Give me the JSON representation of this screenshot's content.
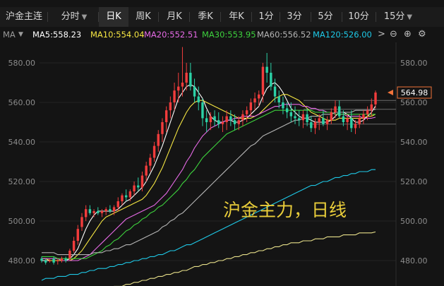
{
  "tabs": [
    {
      "label": "沪金主连",
      "active": false,
      "dropdown": false
    },
    {
      "label": "分时",
      "active": false,
      "dropdown": true
    },
    {
      "label": "日K",
      "active": true,
      "dropdown": false
    },
    {
      "label": "周K",
      "active": false,
      "dropdown": false
    },
    {
      "label": "月K",
      "active": false,
      "dropdown": false
    },
    {
      "label": "季K",
      "active": false,
      "dropdown": false
    },
    {
      "label": "年K",
      "active": false,
      "dropdown": false
    },
    {
      "label": "1分",
      "active": false,
      "dropdown": false
    },
    {
      "label": "3分",
      "active": false,
      "dropdown": false
    },
    {
      "label": "5分",
      "active": false,
      "dropdown": false
    },
    {
      "label": "10分",
      "active": false,
      "dropdown": false
    },
    {
      "label": "15分",
      "active": false,
      "dropdown": true
    }
  ],
  "ma_bar": {
    "prefix": "MA",
    "items": [
      {
        "label": "MA5:558.23",
        "color": "#ffffff"
      },
      {
        "label": "MA10:554.04",
        "color": "#f5e642"
      },
      {
        "label": "MA20:552.51",
        "color": "#e66ae6"
      },
      {
        "label": "MA30:553.95",
        "color": "#3dd13d"
      },
      {
        "label": "MA60:556.52",
        "color": "#b4b4b4"
      },
      {
        "label": "MA120:526.00",
        "color": "#1ec8e6"
      }
    ],
    "tools": {
      "next": ">",
      "zoom_out": "⊖",
      "zoom_in": "⊕",
      "settings": "⚙"
    }
  },
  "chart_data": {
    "type": "candlestick",
    "ylim": [
      470,
      590
    ],
    "yticks": [
      "580.00",
      "560.00",
      "540.00",
      "520.00",
      "500.00",
      "480.00"
    ],
    "last_price": "564.98",
    "annotation": "沪金主力，日线",
    "colors": {
      "up": "#f23c3c",
      "down": "#2bd1a6",
      "price_tag": "#f2733a"
    },
    "reference_lines": [
      561,
      556.5,
      549
    ],
    "candles": [
      [
        481,
        482,
        479,
        480
      ],
      [
        480,
        481,
        478,
        479
      ],
      [
        480,
        481,
        479,
        480
      ],
      [
        481,
        482,
        478,
        479
      ],
      [
        480,
        481,
        478,
        480
      ],
      [
        480,
        482,
        479,
        481
      ],
      [
        481,
        482,
        479,
        480
      ],
      [
        481,
        486,
        480,
        485
      ],
      [
        485,
        492,
        484,
        490
      ],
      [
        490,
        498,
        488,
        496
      ],
      [
        497,
        504,
        495,
        502
      ],
      [
        502,
        508,
        500,
        506
      ],
      [
        506,
        508,
        503,
        504
      ],
      [
        504,
        506,
        502,
        505
      ],
      [
        505,
        507,
        503,
        504
      ],
      [
        504,
        506,
        502,
        505
      ],
      [
        505,
        507,
        503,
        506
      ],
      [
        506,
        508,
        504,
        505
      ],
      [
        505,
        508,
        503,
        507
      ],
      [
        507,
        512,
        505,
        510
      ],
      [
        510,
        514,
        508,
        513
      ],
      [
        513,
        516,
        510,
        512
      ],
      [
        512,
        516,
        510,
        515
      ],
      [
        515,
        520,
        513,
        518
      ],
      [
        518,
        522,
        515,
        517
      ],
      [
        517,
        525,
        515,
        523
      ],
      [
        523,
        530,
        520,
        528
      ],
      [
        528,
        534,
        525,
        532
      ],
      [
        532,
        540,
        530,
        538
      ],
      [
        538,
        546,
        535,
        544
      ],
      [
        544,
        552,
        540,
        550
      ],
      [
        550,
        558,
        545,
        556
      ],
      [
        556,
        563,
        552,
        560
      ],
      [
        560,
        570,
        556,
        566
      ],
      [
        566,
        575,
        560,
        568
      ],
      [
        568,
        588,
        563,
        570
      ],
      [
        570,
        580,
        566,
        575
      ],
      [
        575,
        580,
        566,
        568
      ],
      [
        568,
        572,
        560,
        563
      ],
      [
        563,
        568,
        556,
        560
      ],
      [
        560,
        562,
        548,
        552
      ],
      [
        552,
        556,
        545,
        550
      ],
      [
        550,
        555,
        546,
        553
      ],
      [
        553,
        556,
        548,
        551
      ],
      [
        551,
        555,
        547,
        549
      ],
      [
        549,
        553,
        545,
        550
      ],
      [
        550,
        556,
        546,
        553
      ],
      [
        553,
        556,
        548,
        551
      ],
      [
        551,
        554,
        546,
        549
      ],
      [
        549,
        553,
        546,
        551
      ],
      [
        551,
        556,
        548,
        554
      ],
      [
        554,
        558,
        550,
        556
      ],
      [
        556,
        562,
        553,
        560
      ],
      [
        560,
        565,
        556,
        562
      ],
      [
        562,
        566,
        558,
        564
      ],
      [
        564,
        580,
        560,
        578
      ],
      [
        578,
        585,
        570,
        575
      ],
      [
        575,
        580,
        566,
        568
      ],
      [
        568,
        572,
        560,
        563
      ],
      [
        563,
        566,
        557,
        560
      ],
      [
        560,
        563,
        554,
        557
      ],
      [
        557,
        560,
        552,
        555
      ],
      [
        555,
        560,
        550,
        553
      ],
      [
        553,
        558,
        549,
        552
      ],
      [
        552,
        556,
        548,
        551
      ],
      [
        551,
        556,
        547,
        554
      ],
      [
        554,
        557,
        548,
        550
      ],
      [
        550,
        553,
        545,
        547
      ],
      [
        547,
        552,
        544,
        550
      ],
      [
        550,
        554,
        546,
        552
      ],
      [
        552,
        556,
        548,
        549
      ],
      [
        549,
        553,
        546,
        551
      ],
      [
        551,
        557,
        549,
        555
      ],
      [
        555,
        561,
        552,
        558
      ],
      [
        558,
        561,
        552,
        553
      ],
      [
        553,
        556,
        548,
        550
      ],
      [
        550,
        554,
        546,
        552
      ],
      [
        552,
        556,
        545,
        547
      ],
      [
        547,
        551,
        544,
        549
      ],
      [
        549,
        554,
        547,
        552
      ],
      [
        552,
        556,
        549,
        554
      ],
      [
        554,
        558,
        551,
        556
      ],
      [
        556,
        562,
        553,
        559
      ],
      [
        559,
        566,
        557,
        564.98
      ]
    ],
    "series": [
      {
        "name": "MA5",
        "color": "#ffffff",
        "values": [
          480,
          480,
          480,
          480,
          480,
          480,
          480,
          481,
          483,
          486,
          491,
          496,
          500,
          503,
          505,
          505,
          505,
          505,
          505,
          506,
          508,
          510,
          511,
          513,
          515,
          517,
          520,
          524,
          528,
          533,
          538,
          544,
          550,
          556,
          562,
          565,
          568,
          569,
          568,
          565,
          562,
          557,
          553,
          551,
          550,
          550,
          551,
          551,
          550,
          550,
          551,
          552,
          554,
          556,
          558,
          563,
          567,
          569,
          570,
          568,
          565,
          561,
          557,
          555,
          553,
          552,
          552,
          551,
          550,
          550,
          550,
          550,
          551,
          553,
          555,
          555,
          554,
          552,
          550,
          550,
          551,
          553,
          555,
          558.23
        ]
      },
      {
        "name": "MA10",
        "color": "#f5e642",
        "values": [
          481,
          481,
          480,
          480,
          480,
          480,
          480,
          480,
          481,
          483,
          485,
          488,
          491,
          494,
          497,
          500,
          502,
          503,
          504,
          505,
          506,
          507,
          508,
          509,
          510,
          511,
          513,
          516,
          519,
          523,
          527,
          532,
          537,
          542,
          547,
          551,
          555,
          558,
          560,
          561,
          561,
          560,
          559,
          558,
          557,
          556,
          555,
          554,
          553,
          552,
          552,
          552,
          552,
          553,
          554,
          556,
          558,
          560,
          562,
          563,
          564,
          564,
          563,
          562,
          561,
          559,
          557,
          555,
          554,
          553,
          552,
          551,
          551,
          551,
          552,
          552,
          552,
          552,
          552,
          552,
          552,
          553,
          553,
          554.04
        ]
      },
      {
        "name": "MA20",
        "color": "#e66ae6",
        "values": [
          481,
          481,
          481,
          481,
          481,
          480,
          480,
          480,
          480,
          480,
          481,
          482,
          483,
          485,
          487,
          489,
          491,
          493,
          495,
          497,
          499,
          501,
          502,
          503,
          504,
          505,
          506,
          507,
          508,
          510,
          512,
          514,
          517,
          520,
          523,
          526,
          530,
          533,
          537,
          540,
          543,
          545,
          547,
          548,
          549,
          550,
          551,
          551,
          552,
          552,
          553,
          553,
          553,
          553,
          554,
          555,
          556,
          557,
          558,
          558,
          559,
          559,
          559,
          559,
          559,
          558,
          558,
          557,
          557,
          556,
          556,
          555,
          555,
          554,
          554,
          554,
          553,
          553,
          553,
          553,
          552,
          552,
          552,
          552.51
        ]
      },
      {
        "name": "MA30",
        "color": "#3dd13d",
        "values": [
          482,
          482,
          482,
          482,
          481,
          481,
          481,
          481,
          481,
          481,
          481,
          481,
          482,
          483,
          484,
          485,
          487,
          488,
          490,
          491,
          493,
          495,
          496,
          498,
          499,
          501,
          502,
          504,
          505,
          507,
          508,
          510,
          512,
          514,
          516,
          519,
          521,
          524,
          526,
          529,
          532,
          534,
          536,
          538,
          540,
          542,
          544,
          545,
          546,
          547,
          548,
          549,
          550,
          551,
          552,
          553,
          554,
          555,
          556,
          556,
          556,
          556,
          556,
          556,
          556,
          556,
          556,
          556,
          555,
          555,
          555,
          555,
          555,
          554,
          554,
          554,
          554,
          554,
          554,
          554,
          554,
          554,
          554,
          553.95
        ]
      },
      {
        "name": "MA60",
        "color": "#b4b4b4",
        "values": [
          484,
          484,
          484,
          484,
          483,
          483,
          483,
          483,
          483,
          483,
          483,
          483,
          483,
          484,
          484,
          484,
          485,
          485,
          486,
          486,
          487,
          488,
          488,
          489,
          490,
          491,
          492,
          493,
          494,
          495,
          497,
          498,
          500,
          501,
          503,
          504,
          506,
          508,
          510,
          512,
          514,
          516,
          518,
          520,
          522,
          524,
          526,
          528,
          530,
          532,
          534,
          536,
          538,
          539,
          541,
          543,
          544,
          545,
          546,
          547,
          548,
          549,
          550,
          551,
          551,
          552,
          552,
          553,
          553,
          553,
          554,
          554,
          554,
          555,
          555,
          555,
          555,
          555,
          556,
          556,
          556,
          556,
          556,
          556.52
        ]
      },
      {
        "name": "MA120",
        "color": "#1ec8e6",
        "values": [
          470,
          471,
          471,
          471,
          472,
          472,
          472,
          473,
          473,
          473,
          474,
          474,
          475,
          475,
          476,
          476,
          476,
          477,
          477,
          478,
          478,
          479,
          479,
          480,
          480,
          481,
          481,
          482,
          482,
          483,
          483,
          484,
          485,
          485,
          486,
          487,
          488,
          488,
          489,
          490,
          491,
          492,
          493,
          494,
          495,
          496,
          497,
          498,
          499,
          500,
          501,
          502,
          503,
          504,
          505,
          506,
          507,
          508,
          509,
          510,
          511,
          512,
          513,
          514,
          515,
          516,
          517,
          518,
          518,
          519,
          520,
          520,
          521,
          522,
          522,
          523,
          523,
          524,
          524,
          525,
          525,
          525,
          526,
          526.0
        ]
      },
      {
        "name": "",
        "color": "#e8e08a",
        "values": [
          460,
          460,
          461,
          461,
          461,
          462,
          462,
          462,
          463,
          463,
          463,
          464,
          464,
          465,
          465,
          465,
          466,
          466,
          467,
          467,
          467,
          468,
          468,
          469,
          469,
          470,
          470,
          471,
          471,
          472,
          472,
          473,
          473,
          474,
          474,
          475,
          475,
          476,
          477,
          477,
          478,
          478,
          479,
          479,
          480,
          480,
          481,
          481,
          482,
          482,
          483,
          483,
          484,
          484,
          485,
          485,
          486,
          486,
          487,
          487,
          488,
          488,
          489,
          489,
          489,
          490,
          490,
          490,
          491,
          491,
          491,
          492,
          492,
          492,
          492,
          493,
          493,
          493,
          493,
          494,
          494,
          494,
          494,
          494.5
        ]
      }
    ]
  }
}
